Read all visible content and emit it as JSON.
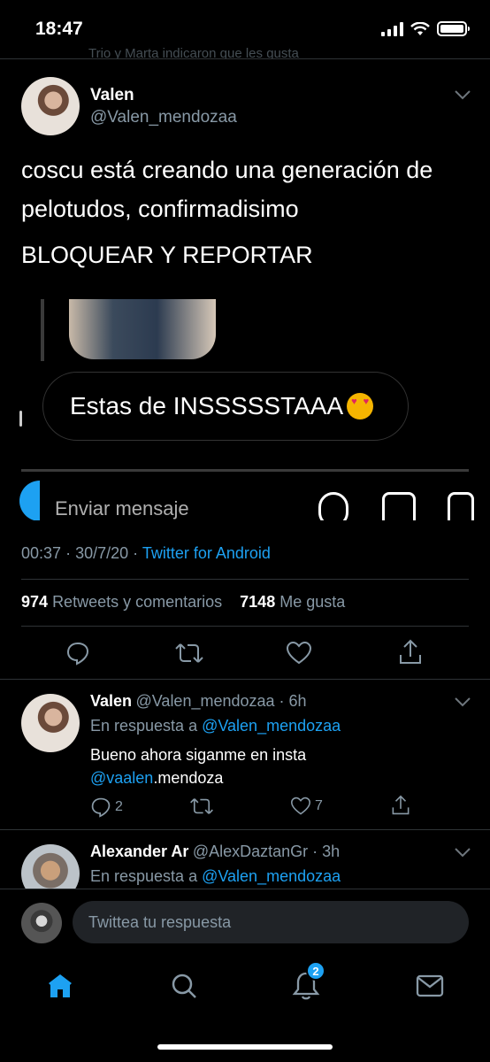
{
  "status_bar": {
    "time": "18:47"
  },
  "partial_header": {
    "text": "Trio y Marta indicaron que les gusta"
  },
  "tweet": {
    "name": "Valen",
    "handle": "@Valen_mendozaa",
    "text_line1": "coscu está creando una generación de",
    "text_line2": "pelotudos, confirmadisimo",
    "text_line3": "BLOQUEAR Y REPORTAR",
    "embedded": {
      "message": "Estas de INSSSSSTAAA",
      "input_placeholder": "Enviar mensaje"
    },
    "time": "00:37",
    "date": "30/7/20",
    "source": "Twitter for Android",
    "retweets_count": "974",
    "retweets_label": "Retweets y comentarios",
    "likes_count": "7148",
    "likes_label": "Me gusta"
  },
  "replies": [
    {
      "name": "Valen",
      "handle": "@Valen_mendozaa",
      "time": "6h",
      "reply_to_label": "En respuesta a",
      "reply_to_handle": "@Valen_mendozaa",
      "body_line1": "Bueno ahora siganme en insta",
      "body_mention": "@vaalen",
      "body_rest": ".mendoza",
      "reply_count": "2",
      "like_count": "7"
    },
    {
      "name": "Alexander Ar",
      "handle": "@AlexDaztanGr",
      "time": "3h",
      "reply_to_label": "En respuesta a",
      "reply_to_handle": "@Valen_mendozaa"
    }
  ],
  "compose": {
    "placeholder": "Twittea tu respuesta"
  },
  "tabbar": {
    "notifications_badge": "2"
  },
  "colors": {
    "accent": "#1da1f2",
    "muted": "#8899a6",
    "background": "#000000"
  }
}
